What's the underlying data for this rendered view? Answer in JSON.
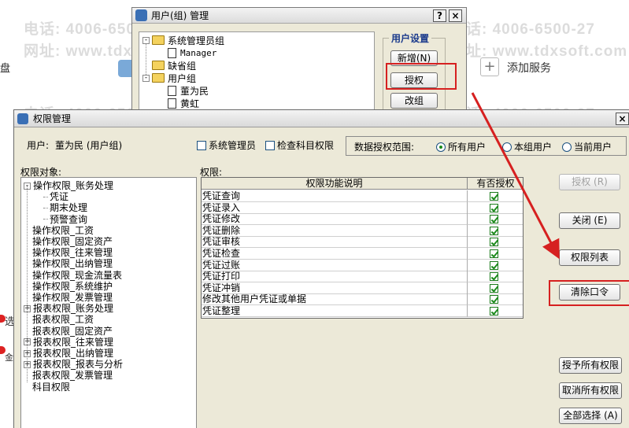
{
  "watermark": {
    "phone": "电话: 4006-6500-27",
    "site": "网址: www.tdxsoft.com"
  },
  "background": {
    "left_label": "盘",
    "add_service": "添加服务",
    "plus_glyph": "+",
    "side_chars": [
      "选",
      "金"
    ]
  },
  "group_window": {
    "title": "用户(组) 管理",
    "help_btn": "?",
    "close_btn": "×",
    "tree": [
      {
        "label": "系统管理员组",
        "kind": "folder",
        "toggle": "-"
      },
      {
        "label": "Manager",
        "kind": "user"
      },
      {
        "label": "缺省组",
        "kind": "folder"
      },
      {
        "label": "用户组",
        "kind": "folder",
        "toggle": "-"
      },
      {
        "label": "董为民",
        "kind": "user"
      },
      {
        "label": "黄虹",
        "kind": "user"
      }
    ],
    "group_title": "用户设置",
    "buttons": {
      "add": "新增(N)",
      "grant": "授权",
      "rename": "改组"
    }
  },
  "perm_window": {
    "title": "权限管理",
    "close_btn": "×",
    "user_label": "用户:",
    "user_value": "董为民 (用户组)",
    "checks": {
      "sysadmin": "系统管理员",
      "check_subject": "检查科目权限"
    },
    "scope_label": "数据授权范围:",
    "scope_options": {
      "all": "所有用户",
      "group": "本组用户",
      "current": "当前用户"
    },
    "selected_scope": "所有用户",
    "objects_label": "权限对象:",
    "perms_label": "权限:",
    "tree": [
      {
        "label": "操作权限_账务处理",
        "toggle": "-"
      },
      {
        "label": "凭证"
      },
      {
        "label": "期末处理"
      },
      {
        "label": "预警查询"
      },
      {
        "label": "操作权限_工资"
      },
      {
        "label": "操作权限_固定资产"
      },
      {
        "label": "操作权限_往来管理"
      },
      {
        "label": "操作权限_出纳管理"
      },
      {
        "label": "操作权限_现金流量表"
      },
      {
        "label": "操作权限_系统维护"
      },
      {
        "label": "操作权限_发票管理"
      },
      {
        "label": "报表权限_账务处理",
        "toggle": "+"
      },
      {
        "label": "报表权限_工资"
      },
      {
        "label": "报表权限_固定资产"
      },
      {
        "label": "报表权限_往来管理",
        "toggle": "+"
      },
      {
        "label": "报表权限_出纳管理",
        "toggle": "+"
      },
      {
        "label": "报表权限_报表与分析",
        "toggle": "+"
      },
      {
        "label": "报表权限_发票管理"
      },
      {
        "label": "科目权限"
      }
    ],
    "grid": {
      "columns": [
        "权限功能说明",
        "有否授权"
      ],
      "rows": [
        {
          "name": "凭证查询",
          "granted": true
        },
        {
          "name": "凭证录入",
          "granted": true
        },
        {
          "name": "凭证修改",
          "granted": true
        },
        {
          "name": "凭证删除",
          "granted": true
        },
        {
          "name": "凭证审核",
          "granted": true
        },
        {
          "name": "凭证检查",
          "granted": true
        },
        {
          "name": "凭证过账",
          "granted": true
        },
        {
          "name": "凭证打印",
          "granted": true
        },
        {
          "name": "凭证冲销",
          "granted": true
        },
        {
          "name": "修改其他用户凭证或单据",
          "granted": true
        },
        {
          "name": "凭证整理",
          "granted": true
        }
      ]
    },
    "buttons": {
      "grant": "授权 (R)",
      "close": "关闭 (E)",
      "list": "权限列表",
      "clear_pw": "清除口令",
      "grant_all": "授予所有权限",
      "revoke_all": "取消所有权限",
      "select_all": "全部选择 (A)"
    }
  },
  "colors": {
    "highlight": "#d62020",
    "dialog_bg": "#ece9d8",
    "check_green": "#1a8a1a"
  }
}
